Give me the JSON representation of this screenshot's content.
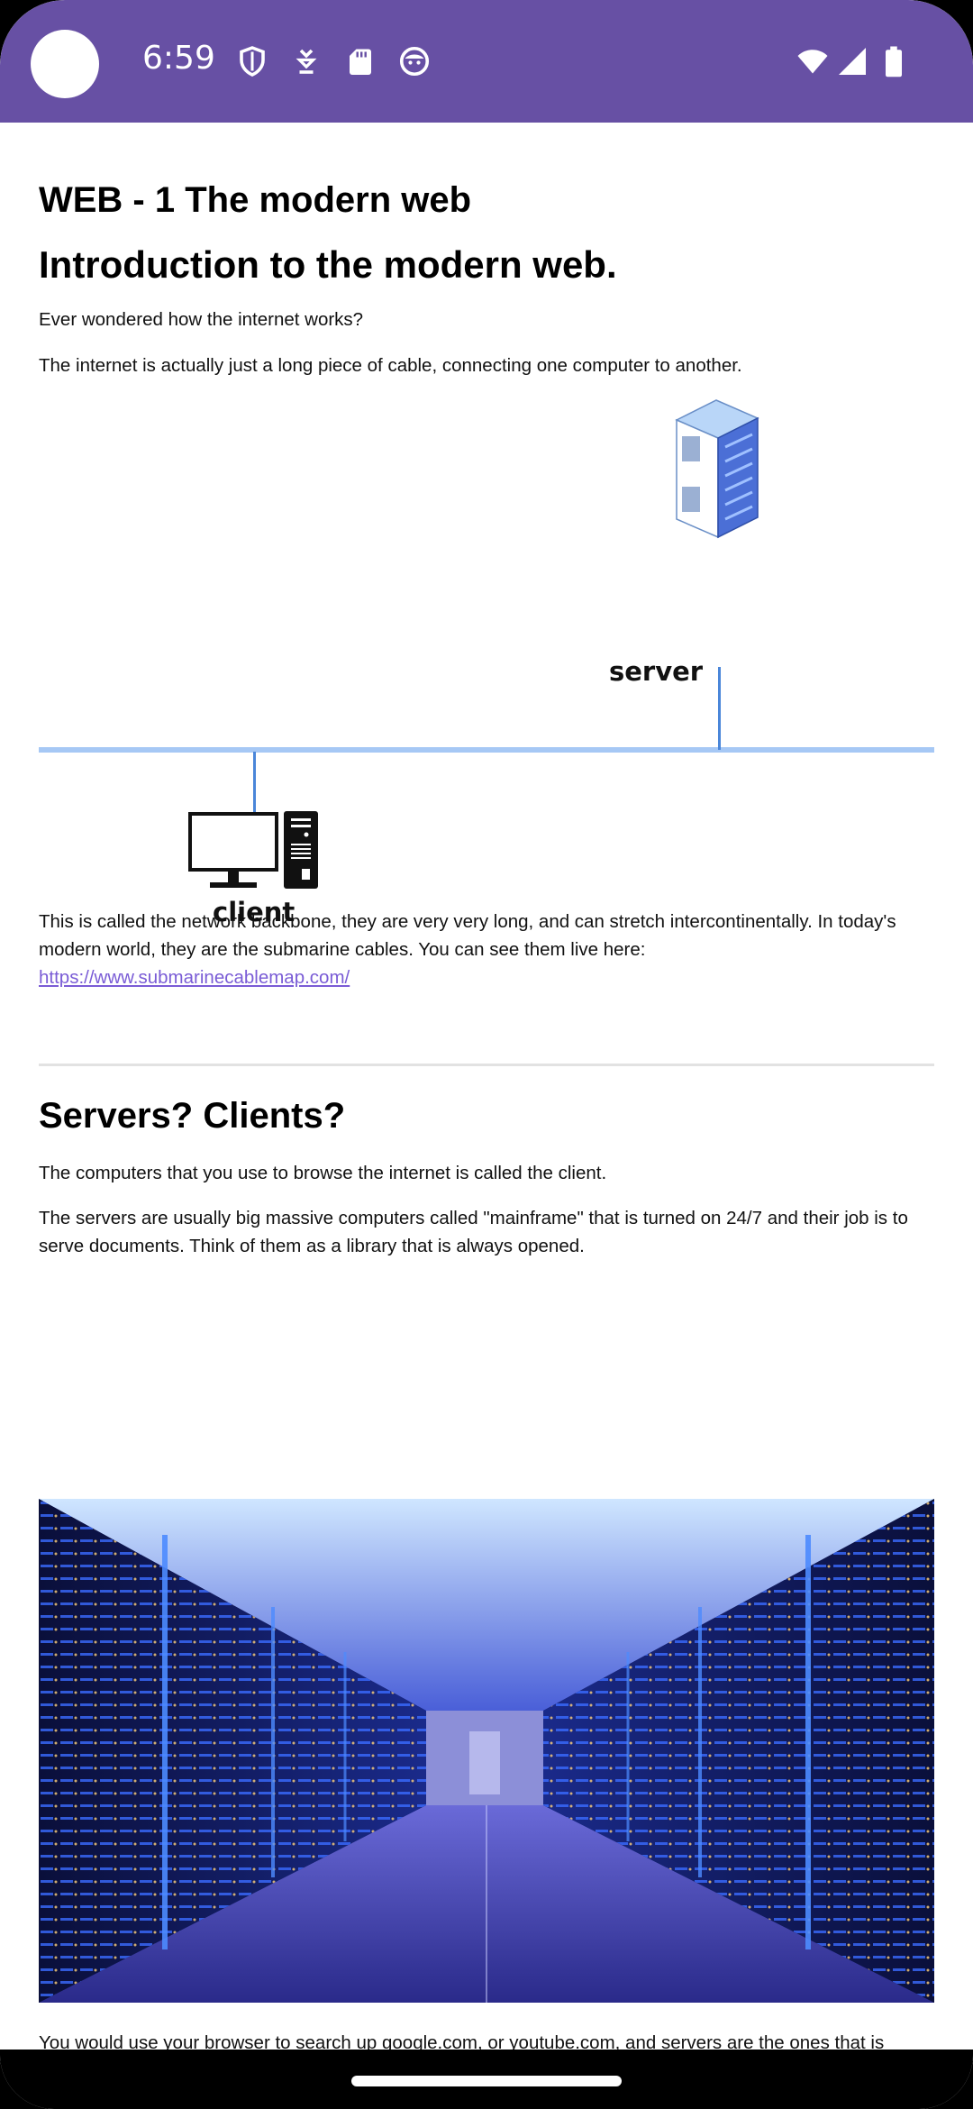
{
  "status_bar": {
    "time": "6:59",
    "left_icons": [
      "shield-icon",
      "download-arrows-icon",
      "sd-card-icon",
      "face-icon"
    ],
    "right_icons": [
      "wifi-icon",
      "signal-icon",
      "battery-icon"
    ],
    "color": "#6750a4"
  },
  "page": {
    "title": "WEB - 1 The modern web",
    "subtitle": "Introduction to the modern web.",
    "p1": "Ever wondered how the internet works?",
    "p2": "The internet is actually just a long piece of cable, connecting one computer to another.",
    "diagram": {
      "server_label": "server",
      "client_label": "client"
    },
    "p3": "This is called the network backbone, they are very very long, and can stretch intercontinentally. In today's modern world, they are the submarine cables. You can see them live here:",
    "link": "https://www.submarinecablemap.com/",
    "section_title": "Servers? Clients?",
    "p4": "The computers that you use to browse the internet is called the client.",
    "p5": "The servers are usually big massive computers called \"mainframe\" that is turned on 24/7 and their job is to serve documents. Think of them as a library that is always opened.",
    "p6_partial": "You would use your browser to search up google.com, or youtube.com, and servers are the ones that is"
  },
  "colors": {
    "accent": "#6750a4",
    "link": "#7a5cd6",
    "cable": "#a6c8f5",
    "connector": "#4a86d9"
  }
}
